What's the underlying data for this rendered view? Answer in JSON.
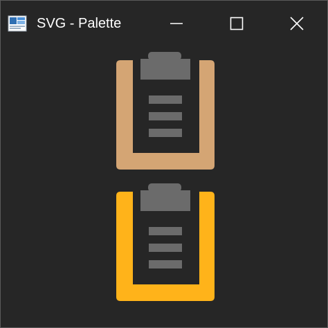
{
  "window": {
    "title": "SVG - Palette",
    "controls": {
      "minimize_icon": "minimize-icon",
      "maximize_icon": "maximize-icon",
      "close_icon": "close-icon"
    }
  },
  "palette": {
    "items": [
      {
        "icon": "clipboard-icon",
        "color": "#d4a574"
      },
      {
        "icon": "clipboard-icon",
        "color": "#ffb31a"
      }
    ],
    "clip_color": "#6b6b6b",
    "line_color": "#6b6b6b"
  },
  "colors": {
    "background": "#262626",
    "title_text": "#ffffff"
  }
}
